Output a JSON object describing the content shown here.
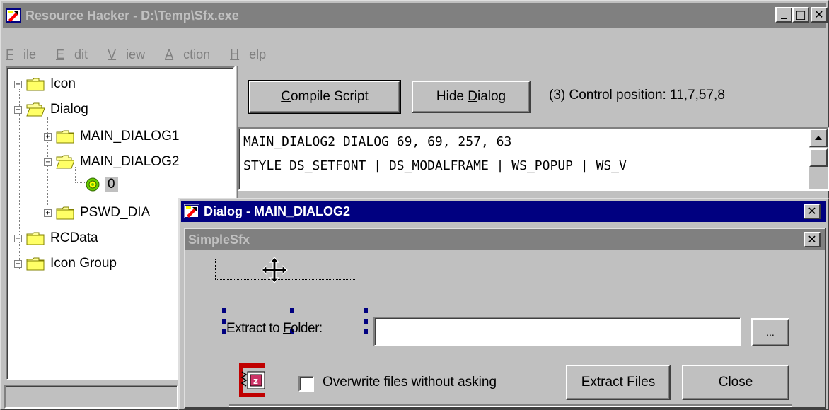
{
  "main_window": {
    "title": "Resource Hacker  -  D:\\Temp\\Sfx.exe",
    "controls": {
      "minimize": "_",
      "maximize": "□",
      "close": "✕"
    }
  },
  "menu": {
    "items": [
      {
        "hot": "F",
        "rest": "ile"
      },
      {
        "hot": "E",
        "rest": "dit"
      },
      {
        "hot": "V",
        "rest": "iew"
      },
      {
        "hot": "A",
        "rest": "ction"
      },
      {
        "hot": "H",
        "rest": "elp"
      }
    ]
  },
  "tree": {
    "icon": "Icon",
    "dialog": "Dialog",
    "main_dialog1": "MAIN_DIALOG1",
    "main_dialog2": "MAIN_DIALOG2",
    "lang_0": "0",
    "pswd_dialog": "PSWD_DIA",
    "rcdata": "RCData",
    "icon_group": "Icon Group"
  },
  "toolbar": {
    "compile_hot": "C",
    "compile_rest": "ompile Script",
    "hide_pre": "Hide ",
    "hide_hot": "D",
    "hide_rest": "ialog",
    "status": "(3)  Control position: 11,7,57,8"
  },
  "editor": {
    "lines": [
      "MAIN_DIALOG2 DIALOG 69, 69, 257, 63",
      "STYLE DS_SETFONT | DS_MODALFRAME | WS_POPUP | WS_V"
    ]
  },
  "dialog_window": {
    "title": "Dialog -  MAIN_DIALOG2",
    "close": "✕"
  },
  "simple_sfx": {
    "title": "SimpleSfx",
    "close": "✕",
    "label_pre": "Extract to ",
    "label_hot": "F",
    "label_rest": "older:",
    "browse": "...",
    "checkbox_pre": "",
    "checkbox_hot": "O",
    "checkbox_rest": "verwrite files without asking",
    "extract_hot": "E",
    "extract_rest": "xtract Files",
    "close_hot": "C",
    "close_rest": "lose"
  },
  "colors": {
    "face": "#c0c0c0",
    "active_title": "#000080",
    "inactive_title": "#808080",
    "folder": "#ffff99"
  }
}
